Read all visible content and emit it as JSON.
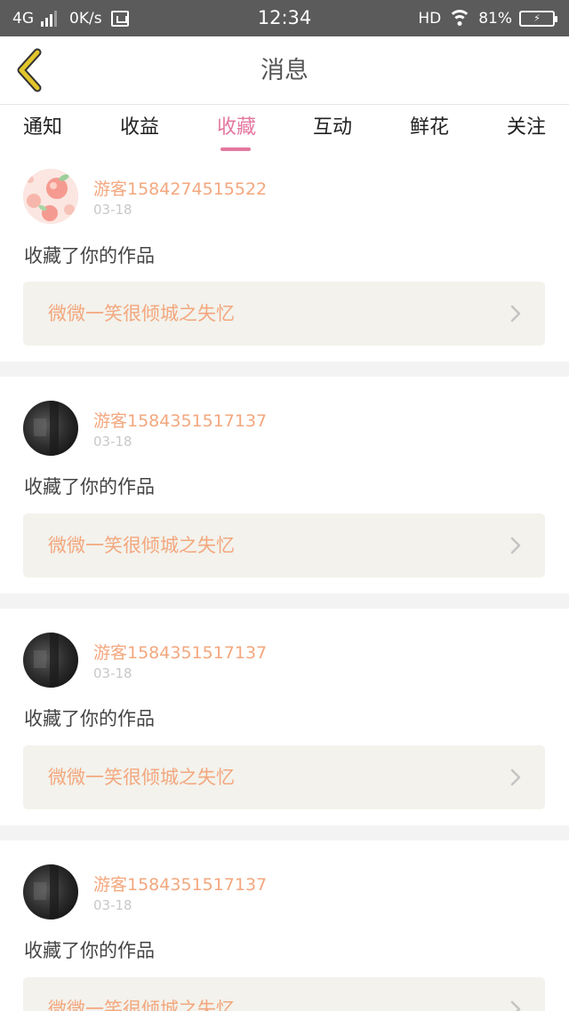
{
  "status_bar": {
    "network": "4G",
    "speed": "0K/s",
    "time": "12:34",
    "hd": "HD",
    "battery": "81%"
  },
  "header": {
    "title": "消息"
  },
  "tabs": [
    {
      "label": "通知",
      "active": false
    },
    {
      "label": "收益",
      "active": false
    },
    {
      "label": "收藏",
      "active": true
    },
    {
      "label": "互动",
      "active": false
    },
    {
      "label": "鲜花",
      "active": false
    },
    {
      "label": "关注",
      "active": false
    }
  ],
  "colors": {
    "accent": "#e4779f",
    "username": "#f3a77e",
    "work_box_bg": "#f3f2ec",
    "back_arrow": "#e2c52c"
  },
  "messages": [
    {
      "username": "游客1584274515522",
      "date": "03-18",
      "action": "收藏了你的作品",
      "work_title": "微微一笑很倾城之失忆",
      "avatar": "peach-avatar"
    },
    {
      "username": "游客1584351517137",
      "date": "03-18",
      "action": "收藏了你的作品",
      "work_title": "微微一笑很倾城之失忆",
      "avatar": "dark-avatar"
    },
    {
      "username": "游客1584351517137",
      "date": "03-18",
      "action": "收藏了你的作品",
      "work_title": "微微一笑很倾城之失忆",
      "avatar": "dark-avatar"
    },
    {
      "username": "游客1584351517137",
      "date": "03-18",
      "action": "收藏了你的作品",
      "work_title": "微微一笑很倾城之失忆",
      "avatar": "dark-avatar"
    }
  ]
}
